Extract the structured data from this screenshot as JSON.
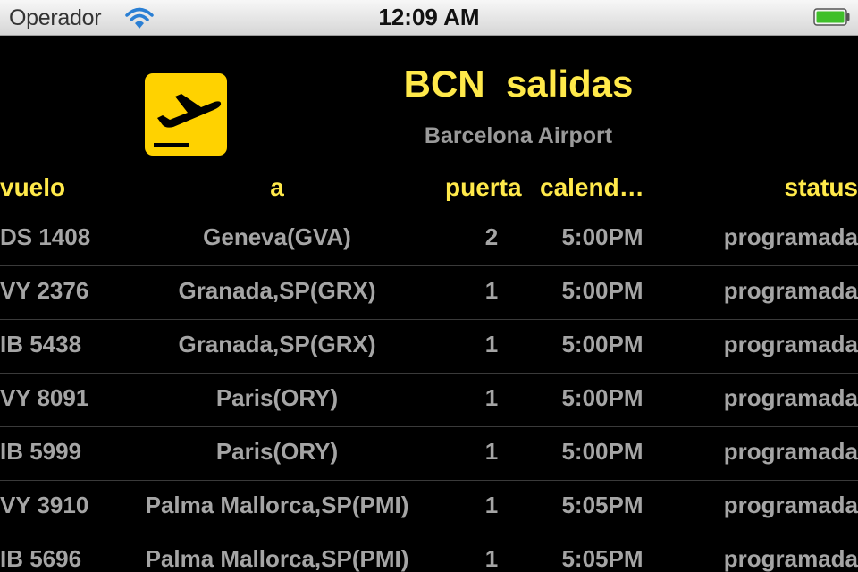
{
  "status_bar": {
    "carrier": "Operador",
    "time": "12:09 AM",
    "wifi_icon": "wifi-icon",
    "battery_icon": "battery-icon"
  },
  "header": {
    "icon": "airplane-departure-icon",
    "title": "BCN  salidas",
    "subtitle": "Barcelona Airport"
  },
  "columns": {
    "flight": "vuelo",
    "destination": "a",
    "gate": "puerta",
    "schedule": "calend…",
    "status": "status"
  },
  "colors": {
    "accent": "#ffe94a",
    "text_secondary": "#a5a5a5",
    "background": "#000000",
    "icon_background": "#ffd200"
  },
  "flights": [
    {
      "flight": "DS 1408",
      "destination": "Geneva(GVA)",
      "gate": "2",
      "time": "5:00PM",
      "status": "programada"
    },
    {
      "flight": "VY 2376",
      "destination": "Granada,SP(GRX)",
      "gate": "1",
      "time": "5:00PM",
      "status": "programada"
    },
    {
      "flight": "IB 5438",
      "destination": "Granada,SP(GRX)",
      "gate": "1",
      "time": "5:00PM",
      "status": "programada"
    },
    {
      "flight": "VY 8091",
      "destination": "Paris(ORY)",
      "gate": "1",
      "time": "5:00PM",
      "status": "programada"
    },
    {
      "flight": "IB 5999",
      "destination": "Paris(ORY)",
      "gate": "1",
      "time": "5:00PM",
      "status": "programada"
    },
    {
      "flight": "VY 3910",
      "destination": "Palma Mallorca,SP(PMI)",
      "gate": "1",
      "time": "5:05PM",
      "status": "programada"
    },
    {
      "flight": "IB 5696",
      "destination": "Palma Mallorca,SP(PMI)",
      "gate": "1",
      "time": "5:05PM",
      "status": "programada"
    }
  ]
}
